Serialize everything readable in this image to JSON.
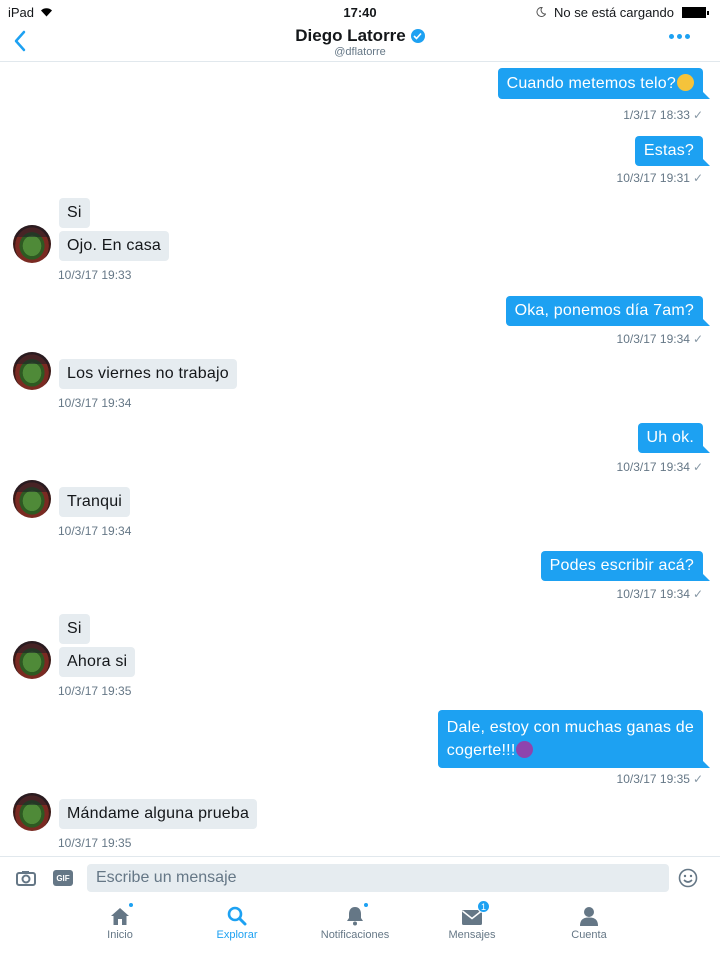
{
  "status_bar": {
    "device": "iPad",
    "time": "17:40",
    "charging": "No se está cargando"
  },
  "header": {
    "name": "Diego Latorre",
    "handle": "@dflatorre"
  },
  "messages": [
    {
      "dir": "out",
      "text": "Cuando metemos telo?",
      "emoji": "smirk-emoji",
      "time": "1/3/17 18:33"
    },
    {
      "dir": "out",
      "text": "Estas?",
      "time": "10/3/17 19:31"
    },
    {
      "dir": "in",
      "text": "Si"
    },
    {
      "dir": "in",
      "text": "Ojo. En casa",
      "time": "10/3/17 19:33"
    },
    {
      "dir": "out",
      "text": "Oka, ponemos día 7am?",
      "time": "10/3/17 19:34"
    },
    {
      "dir": "in",
      "text": "Los viernes no trabajo",
      "time": "10/3/17 19:34"
    },
    {
      "dir": "out",
      "text": "Uh ok.",
      "time": "10/3/17 19:34"
    },
    {
      "dir": "in",
      "text": "Tranqui",
      "time": "10/3/17 19:34"
    },
    {
      "dir": "out",
      "text": "Podes escribir acá?",
      "time": "10/3/17 19:34"
    },
    {
      "dir": "in",
      "text": "Si"
    },
    {
      "dir": "in",
      "text": "Ahora si",
      "time": "10/3/17 19:35"
    },
    {
      "dir": "out",
      "text_line1": "Dale, estoy con muchas ganas de",
      "text_line2": "cogerte!!!",
      "emoji": "devil-emoji",
      "time": "10/3/17 19:35"
    },
    {
      "dir": "in",
      "text": "Mándame alguna prueba",
      "time": "10/3/17 19:35"
    }
  ],
  "composer": {
    "placeholder": "Escribe un mensaje",
    "gif_label": "GIF"
  },
  "tabs": [
    {
      "label": "Inicio",
      "icon": "home-icon"
    },
    {
      "label": "Explorar",
      "icon": "search-icon",
      "active": true
    },
    {
      "label": "Notificaciones",
      "icon": "bell-icon"
    },
    {
      "label": "Mensajes",
      "icon": "envelope-icon",
      "badge": "1"
    },
    {
      "label": "Cuenta",
      "icon": "person-icon"
    }
  ],
  "colors": {
    "accent": "#1da1f2",
    "incoming_bubble": "#e6ecf0",
    "muted_text": "#657786"
  }
}
